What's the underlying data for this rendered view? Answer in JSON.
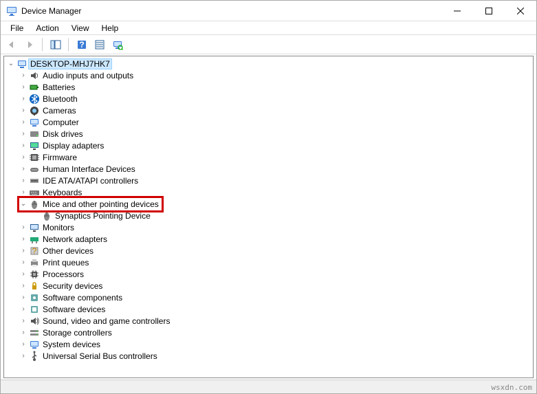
{
  "window": {
    "title": "Device Manager"
  },
  "menu": {
    "file": "File",
    "action": "Action",
    "view": "View",
    "help": "Help"
  },
  "root": {
    "name": "DESKTOP-MHJ7HK7"
  },
  "categories": [
    {
      "id": "audio",
      "label": "Audio inputs and outputs",
      "expanded": false
    },
    {
      "id": "batteries",
      "label": "Batteries",
      "expanded": false
    },
    {
      "id": "bluetooth",
      "label": "Bluetooth",
      "expanded": false
    },
    {
      "id": "cameras",
      "label": "Cameras",
      "expanded": false
    },
    {
      "id": "computer",
      "label": "Computer",
      "expanded": false
    },
    {
      "id": "diskdrives",
      "label": "Disk drives",
      "expanded": false
    },
    {
      "id": "display",
      "label": "Display adapters",
      "expanded": false
    },
    {
      "id": "firmware",
      "label": "Firmware",
      "expanded": false
    },
    {
      "id": "hid",
      "label": "Human Interface Devices",
      "expanded": false
    },
    {
      "id": "ide",
      "label": "IDE ATA/ATAPI controllers",
      "expanded": false
    },
    {
      "id": "keyboards",
      "label": "Keyboards",
      "expanded": false
    },
    {
      "id": "mice",
      "label": "Mice and other pointing devices",
      "expanded": true,
      "highlighted": true,
      "children": [
        {
          "id": "synaptics",
          "label": "Synaptics Pointing Device"
        }
      ]
    },
    {
      "id": "monitors",
      "label": "Monitors",
      "expanded": false
    },
    {
      "id": "network",
      "label": "Network adapters",
      "expanded": false
    },
    {
      "id": "other",
      "label": "Other devices",
      "expanded": false
    },
    {
      "id": "printq",
      "label": "Print queues",
      "expanded": false
    },
    {
      "id": "processors",
      "label": "Processors",
      "expanded": false
    },
    {
      "id": "security",
      "label": "Security devices",
      "expanded": false
    },
    {
      "id": "softcomp",
      "label": "Software components",
      "expanded": false
    },
    {
      "id": "softdev",
      "label": "Software devices",
      "expanded": false
    },
    {
      "id": "sound",
      "label": "Sound, video and game controllers",
      "expanded": false
    },
    {
      "id": "storage",
      "label": "Storage controllers",
      "expanded": false
    },
    {
      "id": "system",
      "label": "System devices",
      "expanded": false
    },
    {
      "id": "usb",
      "label": "Universal Serial Bus controllers",
      "expanded": false
    }
  ],
  "watermark": "wsxdn.com"
}
